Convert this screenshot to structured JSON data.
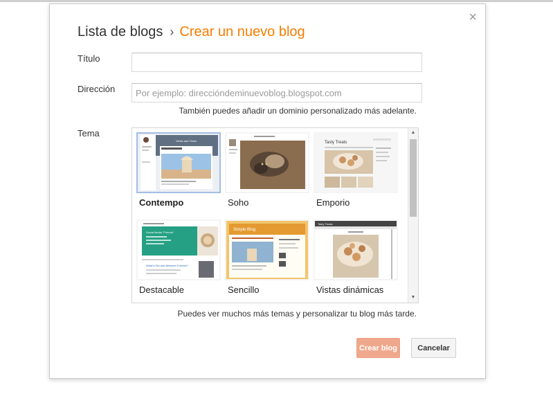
{
  "dialog": {
    "breadcrumb_parent": "Lista de blogs",
    "breadcrumb_sep": "›",
    "breadcrumb_current": "Crear un nuevo blog",
    "close_glyph": "×"
  },
  "form": {
    "title_label": "Título",
    "title_value": "",
    "address_label": "Dirección",
    "address_value": "",
    "address_placeholder": "Por ejemplo: direccióndeminuevoblog.blogspot.com",
    "address_hint": "También puedes añadir un dominio personalizado más adelante.",
    "theme_label": "Tema",
    "themes_hint": "Puedes ver muchos más temas y personalizar tu blog más tarde."
  },
  "themes": [
    {
      "name": "Contempo",
      "selected": true
    },
    {
      "name": "Soho",
      "selected": false
    },
    {
      "name": "Emporio",
      "selected": false
    },
    {
      "name": "Destacable",
      "selected": false
    },
    {
      "name": "Sencillo",
      "selected": false
    },
    {
      "name": "Vistas dinámicas",
      "selected": false
    }
  ],
  "thumb_text": {
    "contempo_header": "Views and Times",
    "emporio_title": "Tasty Treats",
    "destacable_heading": "Social Media \"Friends\"",
    "destacable_subheading": "What's Old and Between Friends?",
    "sencillo_title": "Simple Blog",
    "dinamicas_title": "Tasty Treats"
  },
  "buttons": {
    "create_label": "Crear blog",
    "cancel_label": "Cancelar"
  },
  "colors": {
    "accent_orange": "#f57d00",
    "create_button": "#f0a88c",
    "selected_border": "#a3bde3",
    "destacable_green": "#26a084",
    "sencillo_header": "#e49a31"
  }
}
